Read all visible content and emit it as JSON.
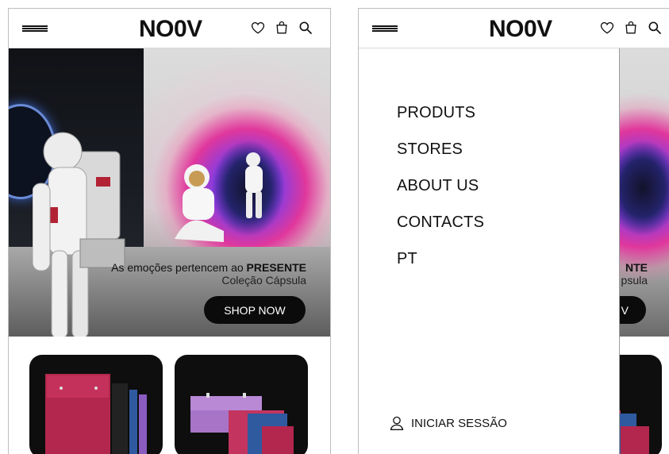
{
  "brand": "NO0V",
  "colors": {
    "accent_black": "#0b0b0b",
    "hero_pink": "#e0379c",
    "hero_violet": "#5a2bd8"
  },
  "header": {
    "icons": [
      "menu-icon",
      "heart-icon",
      "shopping-bag-icon",
      "search-icon"
    ]
  },
  "hero": {
    "title_prefix": "As emoções pertencem ao ",
    "title_emphasis": "PRESENTE",
    "subtitle": "Coleção Cápsula",
    "cta": "SHOP NOW"
  },
  "hero_partial": {
    "title_fragment": "NTE",
    "subtitle_fragment": "psula",
    "cta_fragment": "V"
  },
  "menu": {
    "items": [
      {
        "label": "PRODUTS"
      },
      {
        "label": "STORES"
      },
      {
        "label": "ABOUT US"
      },
      {
        "label": "CONTACTS"
      },
      {
        "label": "PT"
      }
    ],
    "login_label": "INICIAR SESSÃO"
  }
}
